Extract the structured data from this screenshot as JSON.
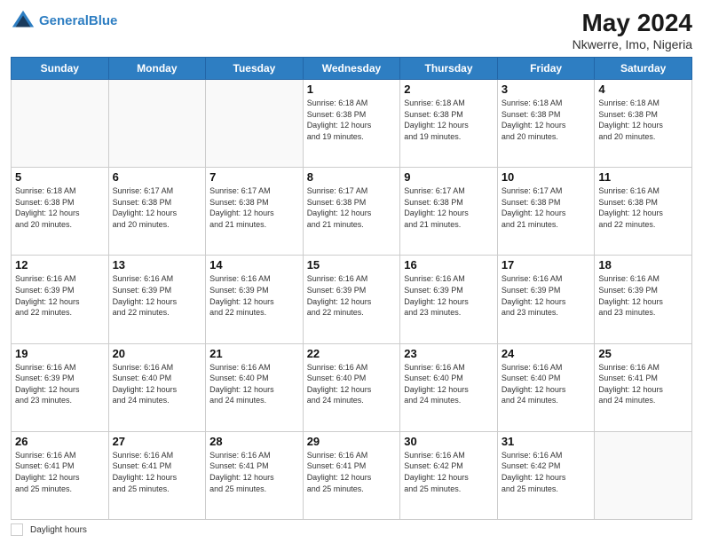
{
  "header": {
    "logo_line1": "General",
    "logo_line2": "Blue",
    "month_year": "May 2024",
    "location": "Nkwerre, Imo, Nigeria"
  },
  "days_of_week": [
    "Sunday",
    "Monday",
    "Tuesday",
    "Wednesday",
    "Thursday",
    "Friday",
    "Saturday"
  ],
  "weeks": [
    [
      {
        "day": "",
        "info": ""
      },
      {
        "day": "",
        "info": ""
      },
      {
        "day": "",
        "info": ""
      },
      {
        "day": "1",
        "info": "Sunrise: 6:18 AM\nSunset: 6:38 PM\nDaylight: 12 hours\nand 19 minutes."
      },
      {
        "day": "2",
        "info": "Sunrise: 6:18 AM\nSunset: 6:38 PM\nDaylight: 12 hours\nand 19 minutes."
      },
      {
        "day": "3",
        "info": "Sunrise: 6:18 AM\nSunset: 6:38 PM\nDaylight: 12 hours\nand 20 minutes."
      },
      {
        "day": "4",
        "info": "Sunrise: 6:18 AM\nSunset: 6:38 PM\nDaylight: 12 hours\nand 20 minutes."
      }
    ],
    [
      {
        "day": "5",
        "info": "Sunrise: 6:18 AM\nSunset: 6:38 PM\nDaylight: 12 hours\nand 20 minutes."
      },
      {
        "day": "6",
        "info": "Sunrise: 6:17 AM\nSunset: 6:38 PM\nDaylight: 12 hours\nand 20 minutes."
      },
      {
        "day": "7",
        "info": "Sunrise: 6:17 AM\nSunset: 6:38 PM\nDaylight: 12 hours\nand 21 minutes."
      },
      {
        "day": "8",
        "info": "Sunrise: 6:17 AM\nSunset: 6:38 PM\nDaylight: 12 hours\nand 21 minutes."
      },
      {
        "day": "9",
        "info": "Sunrise: 6:17 AM\nSunset: 6:38 PM\nDaylight: 12 hours\nand 21 minutes."
      },
      {
        "day": "10",
        "info": "Sunrise: 6:17 AM\nSunset: 6:38 PM\nDaylight: 12 hours\nand 21 minutes."
      },
      {
        "day": "11",
        "info": "Sunrise: 6:16 AM\nSunset: 6:38 PM\nDaylight: 12 hours\nand 22 minutes."
      }
    ],
    [
      {
        "day": "12",
        "info": "Sunrise: 6:16 AM\nSunset: 6:39 PM\nDaylight: 12 hours\nand 22 minutes."
      },
      {
        "day": "13",
        "info": "Sunrise: 6:16 AM\nSunset: 6:39 PM\nDaylight: 12 hours\nand 22 minutes."
      },
      {
        "day": "14",
        "info": "Sunrise: 6:16 AM\nSunset: 6:39 PM\nDaylight: 12 hours\nand 22 minutes."
      },
      {
        "day": "15",
        "info": "Sunrise: 6:16 AM\nSunset: 6:39 PM\nDaylight: 12 hours\nand 22 minutes."
      },
      {
        "day": "16",
        "info": "Sunrise: 6:16 AM\nSunset: 6:39 PM\nDaylight: 12 hours\nand 23 minutes."
      },
      {
        "day": "17",
        "info": "Sunrise: 6:16 AM\nSunset: 6:39 PM\nDaylight: 12 hours\nand 23 minutes."
      },
      {
        "day": "18",
        "info": "Sunrise: 6:16 AM\nSunset: 6:39 PM\nDaylight: 12 hours\nand 23 minutes."
      }
    ],
    [
      {
        "day": "19",
        "info": "Sunrise: 6:16 AM\nSunset: 6:39 PM\nDaylight: 12 hours\nand 23 minutes."
      },
      {
        "day": "20",
        "info": "Sunrise: 6:16 AM\nSunset: 6:40 PM\nDaylight: 12 hours\nand 24 minutes."
      },
      {
        "day": "21",
        "info": "Sunrise: 6:16 AM\nSunset: 6:40 PM\nDaylight: 12 hours\nand 24 minutes."
      },
      {
        "day": "22",
        "info": "Sunrise: 6:16 AM\nSunset: 6:40 PM\nDaylight: 12 hours\nand 24 minutes."
      },
      {
        "day": "23",
        "info": "Sunrise: 6:16 AM\nSunset: 6:40 PM\nDaylight: 12 hours\nand 24 minutes."
      },
      {
        "day": "24",
        "info": "Sunrise: 6:16 AM\nSunset: 6:40 PM\nDaylight: 12 hours\nand 24 minutes."
      },
      {
        "day": "25",
        "info": "Sunrise: 6:16 AM\nSunset: 6:41 PM\nDaylight: 12 hours\nand 24 minutes."
      }
    ],
    [
      {
        "day": "26",
        "info": "Sunrise: 6:16 AM\nSunset: 6:41 PM\nDaylight: 12 hours\nand 25 minutes."
      },
      {
        "day": "27",
        "info": "Sunrise: 6:16 AM\nSunset: 6:41 PM\nDaylight: 12 hours\nand 25 minutes."
      },
      {
        "day": "28",
        "info": "Sunrise: 6:16 AM\nSunset: 6:41 PM\nDaylight: 12 hours\nand 25 minutes."
      },
      {
        "day": "29",
        "info": "Sunrise: 6:16 AM\nSunset: 6:41 PM\nDaylight: 12 hours\nand 25 minutes."
      },
      {
        "day": "30",
        "info": "Sunrise: 6:16 AM\nSunset: 6:42 PM\nDaylight: 12 hours\nand 25 minutes."
      },
      {
        "day": "31",
        "info": "Sunrise: 6:16 AM\nSunset: 6:42 PM\nDaylight: 12 hours\nand 25 minutes."
      },
      {
        "day": "",
        "info": ""
      }
    ]
  ],
  "footer": {
    "legend_label": "Daylight hours"
  }
}
